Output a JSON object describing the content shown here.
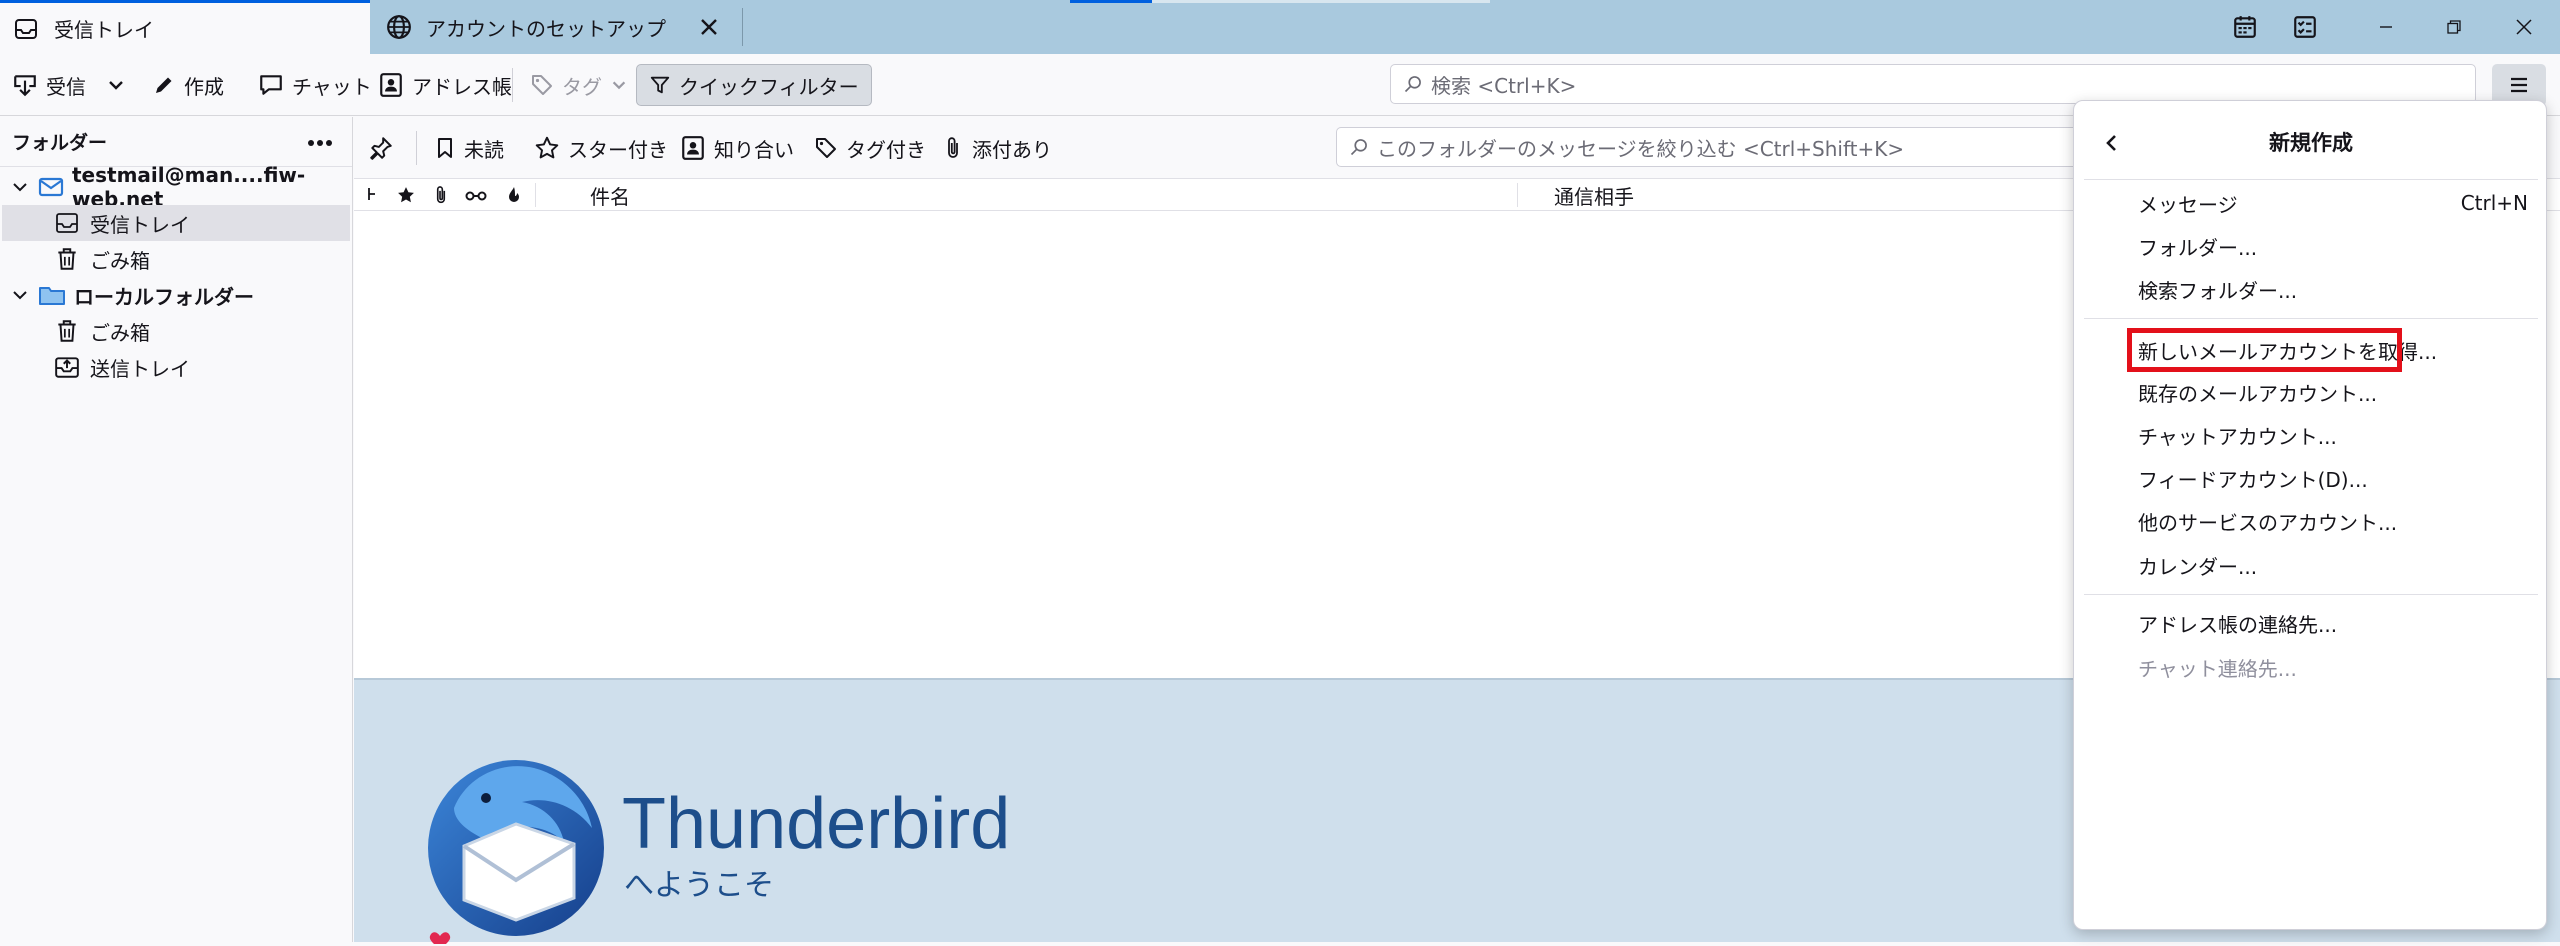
{
  "tabs": [
    {
      "label": "受信トレイ",
      "icon": "inbox-icon"
    },
    {
      "label": "アカウントのセットアップ",
      "icon": "globe-icon"
    }
  ],
  "toolbar": {
    "get_messages": "受信",
    "write": "作成",
    "chat": "チャット",
    "address_book": "アドレス帳",
    "tag": "タグ",
    "quick_filter": "クイックフィルター",
    "search_placeholder": "検索 <Ctrl+K>"
  },
  "folder_pane": {
    "header": "フォルダー",
    "folders": [
      {
        "label": "testmail@man....fiw-web.net",
        "icon": "mail-account-icon"
      },
      {
        "label": "受信トレイ",
        "icon": "inbox-icon"
      },
      {
        "label": "ごみ箱",
        "icon": "trash-icon"
      },
      {
        "label": "ローカルフォルダー",
        "icon": "folder-icon"
      },
      {
        "label": "ごみ箱",
        "icon": "trash-icon"
      },
      {
        "label": "送信トレイ",
        "icon": "outbox-icon"
      }
    ]
  },
  "filter_bar": {
    "unread": "未読",
    "starred": "スター付き",
    "contact": "知り合い",
    "tags": "タグ付き",
    "attachment": "添付あり",
    "search_placeholder": "このフォルダーのメッセージを絞り込む <Ctrl+Shift+K>"
  },
  "thread_columns": {
    "subject": "件名",
    "correspondents": "通信相手"
  },
  "start_page": {
    "title": "Thunderbird",
    "subtitle": "へようこそ"
  },
  "app_menu": {
    "title": "新規作成",
    "items": [
      {
        "label": "メッセージ",
        "shortcut": "Ctrl+N"
      },
      {
        "label": "フォルダー..."
      },
      {
        "label": "検索フォルダー..."
      },
      {
        "label": "新しいメールアカウントを取得..."
      },
      {
        "label": "既存のメールアカウント..."
      },
      {
        "label": "チャットアカウント..."
      },
      {
        "label": "フィードアカウント(D)..."
      },
      {
        "label": "他のサービスのアカウント..."
      },
      {
        "label": "カレンダー..."
      },
      {
        "label": "アドレス帳の連絡先..."
      },
      {
        "label": "チャット連絡先..."
      }
    ]
  },
  "colors": {
    "tabbar": "#a9c9de",
    "accent": "#0060df",
    "highlight": "#e3101a",
    "brand": "#1d4e8b"
  }
}
